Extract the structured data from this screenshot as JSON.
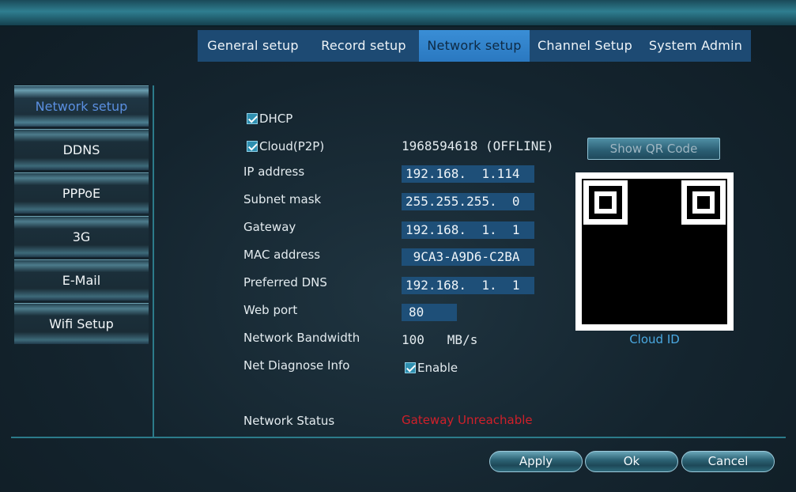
{
  "tabs": [
    "General setup",
    "Record setup",
    "Network setup",
    "Channel Setup",
    "System Admin"
  ],
  "sidebar": {
    "items": [
      "Network setup",
      "DDNS",
      "PPPoE",
      "3G",
      "E-Mail",
      "Wifi Setup"
    ]
  },
  "form": {
    "dhcp_label": "DHCP",
    "cloud_label": "Cloud(P2P)",
    "cloud_value": "1968594618  (OFFLINE)",
    "ip_label": "IP address",
    "ip_value": "192.168.  1.114",
    "subnet_label": "Subnet mask",
    "subnet_value": "255.255.255.  0",
    "gateway_label": "Gateway",
    "gateway_value": "192.168.  1.  1",
    "mac_label": "MAC address",
    "mac_value": " 9CA3-A9D6-C2BA",
    "dns_label": "Preferred DNS",
    "dns_value": "192.168.  1.  1",
    "webport_label": "Web port",
    "webport_value": "80",
    "bandwidth_label": "Network Bandwidth",
    "bandwidth_value": "100   MB/s",
    "diagnose_label": "Net Diagnose Info",
    "enable_label": "Enable",
    "status_label": "Network Status",
    "status_value": "Gateway Unreachable"
  },
  "qr": {
    "button_label": "Show QR Code",
    "caption": "Cloud ID"
  },
  "buttons": {
    "apply": "Apply",
    "ok": "Ok",
    "cancel": "Cancel"
  },
  "colors": {
    "active_tab": "#3a8ed6",
    "status_error": "#d0202a",
    "caption": "#4aa8e0"
  }
}
